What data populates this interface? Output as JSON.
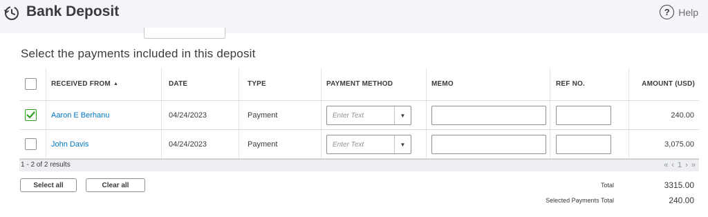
{
  "header": {
    "title": "Bank Deposit",
    "help_label": "Help",
    "help_glyph": "?"
  },
  "section_title": "Select the payments included in this deposit",
  "table": {
    "columns": {
      "received_from": "RECEIVED FROM",
      "sort_indicator": "▲",
      "date": "DATE",
      "type": "TYPE",
      "payment_method": "PAYMENT METHOD",
      "memo": "MEMO",
      "ref_no": "REF NO.",
      "amount": "AMOUNT (USD)"
    },
    "rows": [
      {
        "checked": true,
        "received_from": "Aaron E Berhanu",
        "date": "04/24/2023",
        "type": "Payment",
        "payment_method_placeholder": "Enter Text",
        "memo": "",
        "ref_no": "",
        "amount": "240.00"
      },
      {
        "checked": false,
        "received_from": "John Davis",
        "date": "04/24/2023",
        "type": "Payment",
        "payment_method_placeholder": "Enter Text",
        "memo": "",
        "ref_no": "",
        "amount": "3,075.00"
      }
    ],
    "results_text": "1 - 2 of 2 results",
    "pager": "« ‹ 1 › »"
  },
  "actions": {
    "select_all": "Select all",
    "clear_all": "Clear all"
  },
  "totals": {
    "total_label": "Total",
    "total_value": "3315.00",
    "selected_label": "Selected Payments Total",
    "selected_value": "240.00"
  },
  "colors": {
    "accent_green": "#2ca01c",
    "link_blue": "#0077c5",
    "header_bg": "#f4f5f8"
  },
  "icons": {
    "header": "deposit-clock-icon",
    "check": "checkmark-icon",
    "dropdown": "caret-down-icon"
  }
}
